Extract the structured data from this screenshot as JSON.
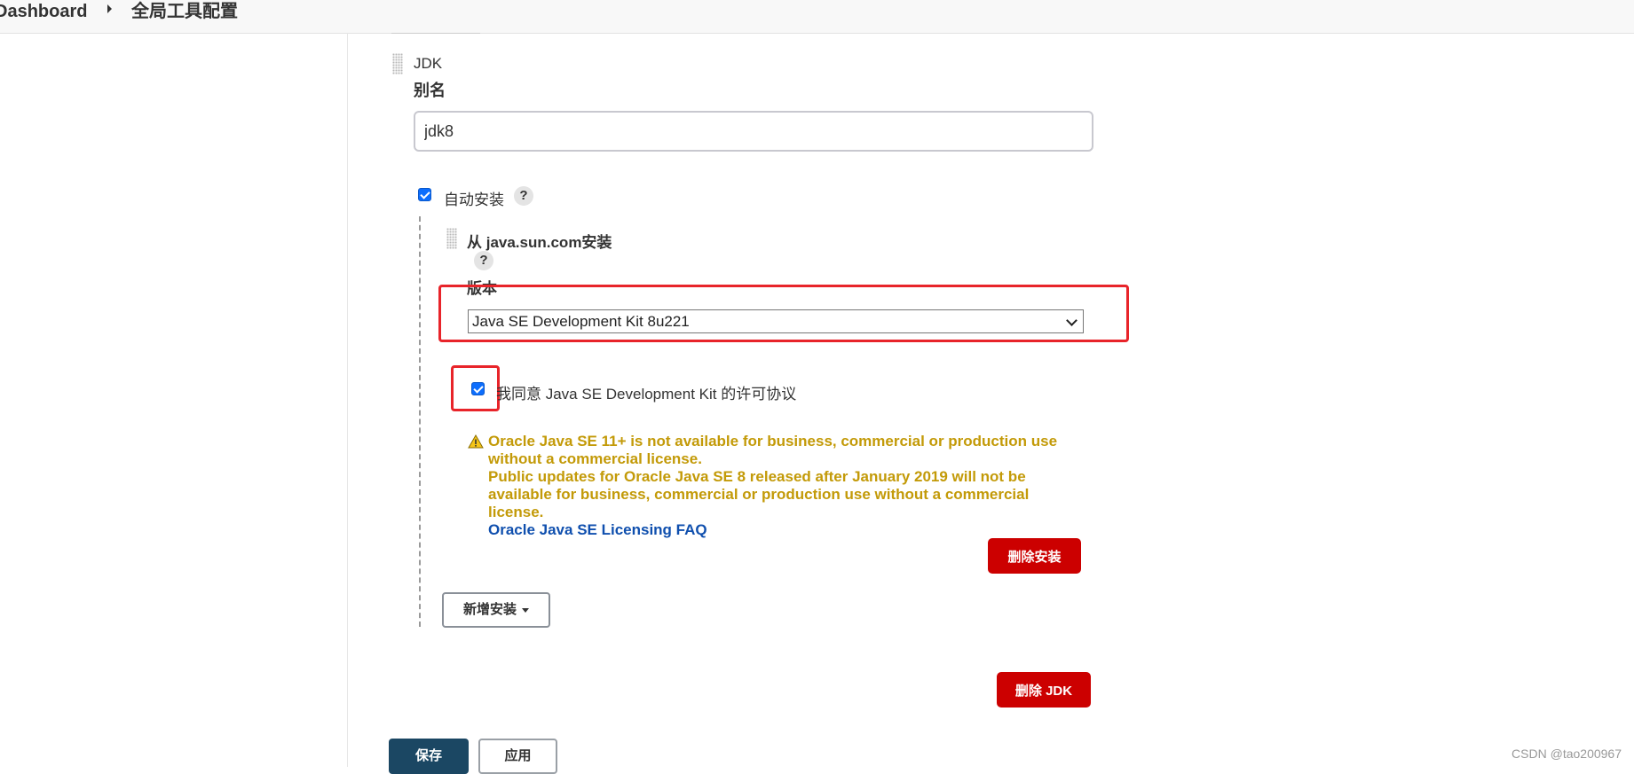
{
  "breadcrumb": {
    "root": "Dashboard",
    "current": "全局工具配置"
  },
  "jdk": {
    "section_title": "JDK",
    "alias_label": "别名",
    "alias_value": "jdk8",
    "auto_install_label": "自动安装",
    "auto_install_checked": true,
    "help_symbol": "?",
    "installer": {
      "title": "从 java.sun.com安装",
      "version_label": "版本",
      "version_selected": "Java SE Development Kit 8u221",
      "agree_label": "我同意 Java SE Development Kit 的许可协议",
      "agree_checked": true,
      "warning_lines": [
        "Oracle Java SE 11+ is not available for business, commercial or production use",
        "without a commercial license.",
        "Public updates for Oracle Java SE 8 released after January 2019 will not be",
        "available for business, commercial or production use without a commercial",
        "license."
      ],
      "faq_link": "Oracle Java SE Licensing FAQ",
      "delete_installer_label": "删除安装"
    },
    "add_installer_label": "新增安装",
    "delete_jdk_label": "删除 JDK"
  },
  "footer": {
    "save_label": "保存",
    "apply_label": "应用"
  },
  "watermark": "CSDN @tao200967",
  "colors": {
    "danger": "#cc0000",
    "warning_text": "#c39a08",
    "link": "#0f4fae",
    "annotation": "#e8242a",
    "primary": "#1b4763"
  }
}
